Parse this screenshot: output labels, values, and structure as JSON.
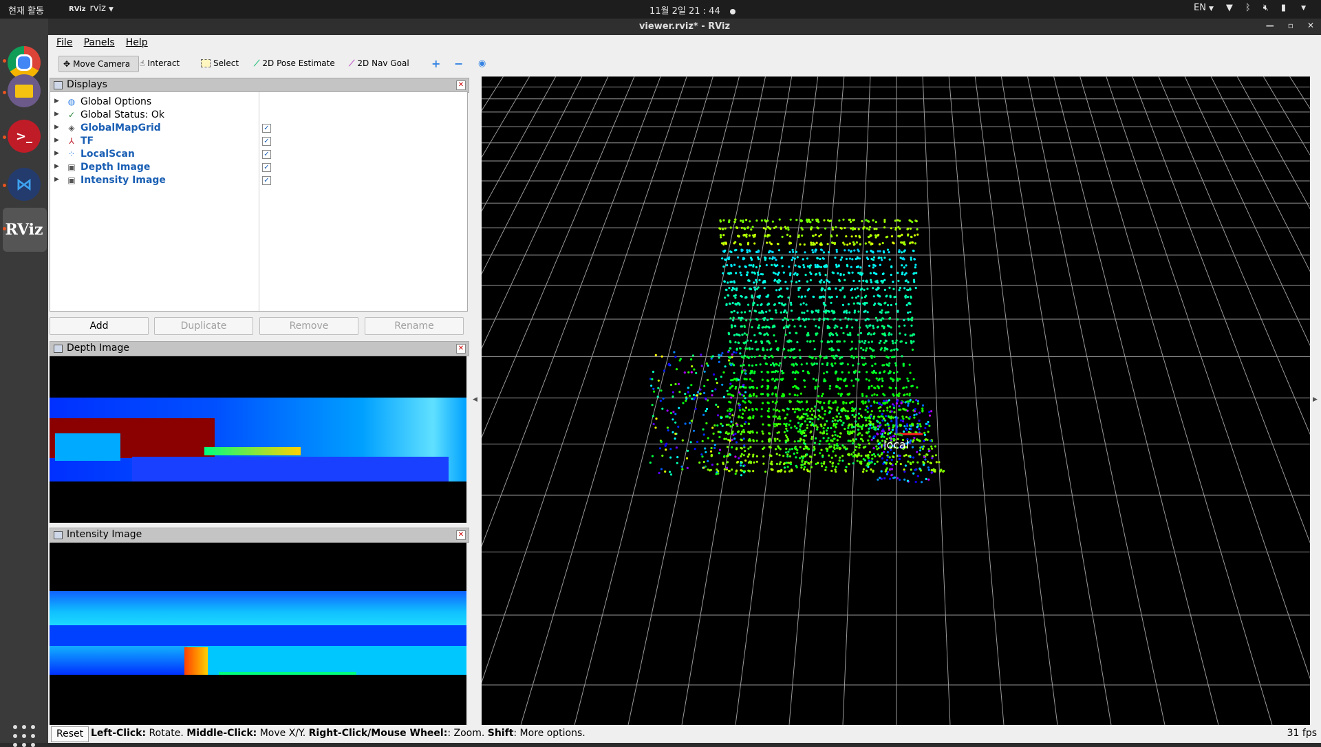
{
  "topbar": {
    "activities": "현재 활동",
    "app_icon": "RViz",
    "app_name": "rviz",
    "clock": "11월 2일  21 : 44",
    "lang": "EN"
  },
  "dock": {
    "apps": [
      "chrome-icon",
      "files-icon",
      "terminal-icon",
      "vscode-icon",
      "rviz-icon"
    ],
    "rviz_label": "RViz"
  },
  "window": {
    "title": "viewer.rviz* - RViz"
  },
  "menu": {
    "file": "File",
    "panels": "Panels",
    "help": "Help"
  },
  "toolbar": {
    "move_camera": "Move Camera",
    "interact": "Interact",
    "select": "Select",
    "pose_estimate": "2D Pose Estimate",
    "nav_goal": "2D Nav Goal",
    "colors": {
      "pose": "#2ec27e",
      "nav": "#c061cb"
    }
  },
  "displays": {
    "title": "Displays",
    "items": [
      {
        "label": "Global Options",
        "icon": "globe-icon",
        "checked": null,
        "highlight": false
      },
      {
        "label": "Global Status: Ok",
        "icon": "check-icon",
        "checked": null,
        "highlight": false
      },
      {
        "label": "GlobalMapGrid",
        "icon": "grid-icon",
        "checked": true,
        "highlight": true
      },
      {
        "label": "TF",
        "icon": "axes-icon",
        "checked": true,
        "highlight": true
      },
      {
        "label": "LocalScan",
        "icon": "pointcloud-icon",
        "checked": true,
        "highlight": true
      },
      {
        "label": "Depth Image",
        "icon": "image-icon",
        "checked": true,
        "highlight": true
      },
      {
        "label": "Intensity Image",
        "icon": "image-icon",
        "checked": true,
        "highlight": true
      }
    ],
    "buttons": {
      "add": "Add",
      "duplicate": "Duplicate",
      "remove": "Remove",
      "rename": "Rename"
    }
  },
  "depth_panel": {
    "title": "Depth Image"
  },
  "intensity_panel": {
    "title": "Intensity Image"
  },
  "view": {
    "frame_label": "local",
    "background": "#000000"
  },
  "status": {
    "reset": "Reset",
    "help_parts": [
      {
        "b": "Left-Click:",
        "t": " Rotate. "
      },
      {
        "b": "Middle-Click:",
        "t": " Move X/Y. "
      },
      {
        "b": "Right-Click/Mouse Wheel:",
        "t": ": Zoom. "
      },
      {
        "b": "Shift",
        "t": ": More options."
      }
    ],
    "fps": "31 fps"
  }
}
